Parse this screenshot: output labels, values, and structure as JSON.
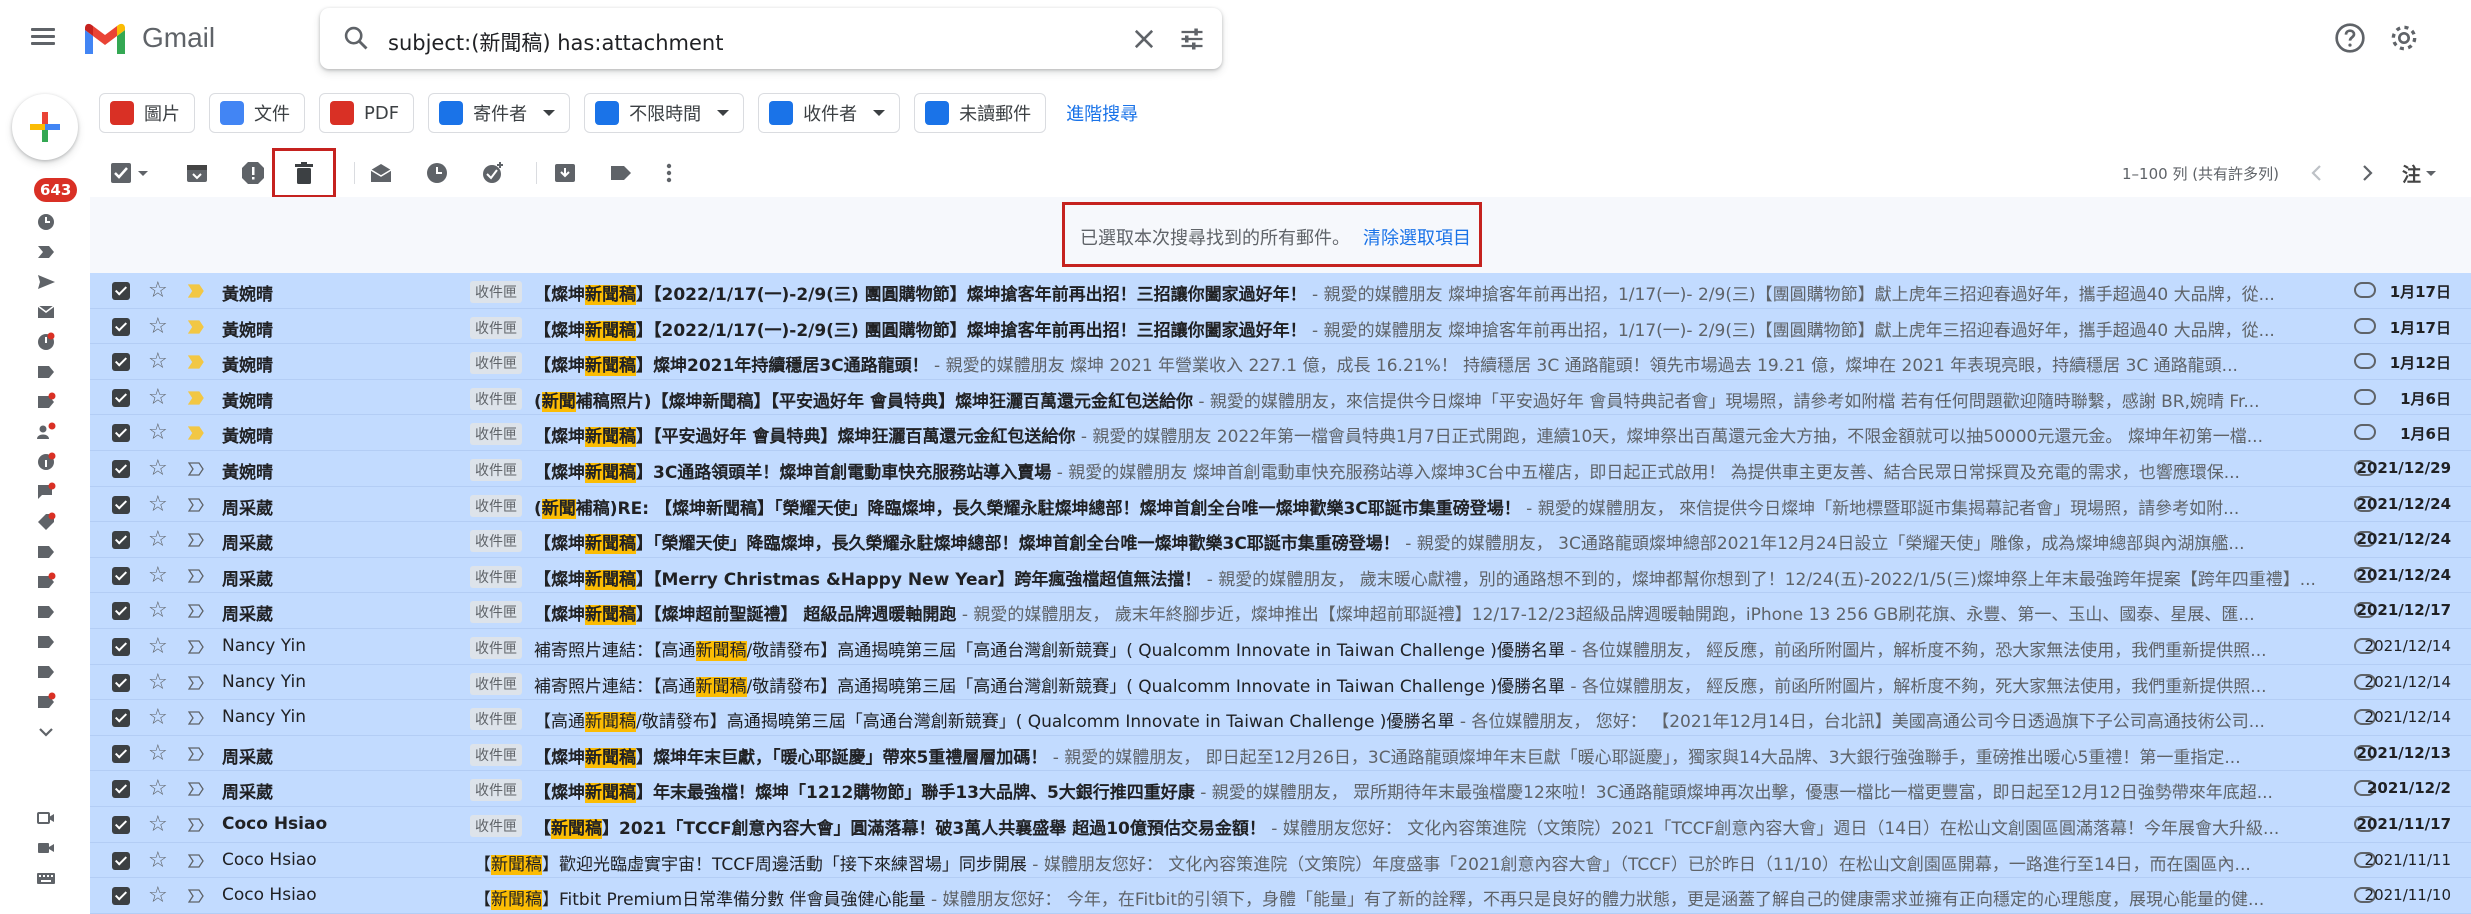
{
  "app": {
    "name": "Gmail"
  },
  "search": {
    "query": "subject:(新聞稿) has:attachment"
  },
  "rail": {
    "unread_count": "643"
  },
  "chips": [
    {
      "label": "圖片",
      "color": "#d93025",
      "icon": "image-icon",
      "dropdown": false
    },
    {
      "label": "文件",
      "color": "#4285f4",
      "icon": "doc-icon",
      "dropdown": false
    },
    {
      "label": "PDF",
      "color": "#d93025",
      "icon": "pdf-icon",
      "dropdown": false
    },
    {
      "label": "寄件者",
      "color": "#1a73e8",
      "icon": "person-icon",
      "dropdown": true
    },
    {
      "label": "不限時間",
      "color": "#1a73e8",
      "icon": "calendar-icon",
      "dropdown": true
    },
    {
      "label": "收件者",
      "color": "#1a73e8",
      "icon": "send-icon",
      "dropdown": true
    },
    {
      "label": "未讀郵件",
      "color": "#1a73e8",
      "icon": "unread-mail-icon",
      "dropdown": false
    }
  ],
  "advanced_search": "進階搜尋",
  "toolbar": {
    "pager": "1–100 列 (共有許多列)",
    "sort": "注"
  },
  "banner": {
    "text": "已選取本次搜尋找到的所有郵件。",
    "clear_link": "清除選取項目"
  },
  "emails": [
    {
      "sender": "黃婉晴",
      "label": "收件匣",
      "pre": "【燦坤",
      "hl": "新聞稿",
      "post": "】【2022/1/17(一)-2/9(三) 團圓購物節】燦坤搶客年前再出招！三招讓你闔家過好年！",
      "snippet": " - 親愛的媒體朋友 燦坤搶客年前再出招，1/17(一)- 2/9(三)【團圓購物節】獻上虎年三招迎春過好年，攜手超過40 大品牌，從...",
      "date": "1月17日",
      "important": true,
      "unread": true
    },
    {
      "sender": "黃婉晴",
      "label": "收件匣",
      "pre": "【燦坤",
      "hl": "新聞稿",
      "post": "】【2022/1/17(一)-2/9(三) 團圓購物節】燦坤搶客年前再出招！三招讓你闔家過好年！",
      "snippet": " - 親愛的媒體朋友 燦坤搶客年前再出招，1/17(一)- 2/9(三)【團圓購物節】獻上虎年三招迎春過好年，攜手超過40 大品牌，從...",
      "date": "1月17日",
      "important": true,
      "unread": true
    },
    {
      "sender": "黃婉晴",
      "label": "收件匣",
      "pre": "【燦坤",
      "hl": "新聞稿",
      "post": "】燦坤2021年持續穩居3C通路龍頭！",
      "snippet": " - 親愛的媒體朋友 燦坤 2021 年營業收入 227.1 億，成長 16.21%！ 持續穩居 3C 通路龍頭！領先市場過去 19.21 億，燦坤在 2021 年表現亮眼，持續穩居 3C 通路龍頭...",
      "date": "1月12日",
      "important": true,
      "unread": true
    },
    {
      "sender": "黃婉晴",
      "label": "收件匣",
      "pre": "(",
      "hl": "新聞",
      "post": "補稿照片)【燦坤新聞稿】【平安過好年 會員特典】燦坤狂灑百萬還元金紅包送給你",
      "snippet": " - 親愛的媒體朋友，來信提供今日燦坤「平安過好年 會員特典記者會」現場照，請參考如附檔 若有任何問題歡迎隨時聯繫，感謝 BR,婉晴 Fr...",
      "date": "1月6日",
      "important": true,
      "unread": true
    },
    {
      "sender": "黃婉晴",
      "label": "收件匣",
      "pre": "【燦坤",
      "hl": "新聞稿",
      "post": "】【平安過好年 會員特典】燦坤狂灑百萬還元金紅包送給你",
      "snippet": " - 親愛的媒體朋友 2022年第一檔會員特典1月7日正式開跑，連續10天，燦坤祭出百萬還元金大方抽，不限金額就可以抽50000元還元金。 燦坤年初第一檔...",
      "date": "1月6日",
      "important": true,
      "unread": true
    },
    {
      "sender": "黃婉晴",
      "label": "收件匣",
      "pre": "【燦坤",
      "hl": "新聞稿",
      "post": "】3C通路領頭羊！燦坤首創電動車快充服務站導入賣場",
      "snippet": " - 親愛的媒體朋友 燦坤首創電動車快充服務站導入燦坤3C台中五權店，即日起正式啟用！ 為提供車主更友善、結合民眾日常採買及充電的需求，也響應環保...",
      "date": "2021/12/29",
      "important": false,
      "unread": true
    },
    {
      "sender": "周采葳",
      "label": "收件匣",
      "pre": "(",
      "hl": "新聞",
      "post": "補稿)RE: 【燦坤新聞稿】「榮耀天使」降臨燦坤，長久榮耀永駐燦坤總部！燦坤首創全台唯一燦坤歡樂3C耶誕市集重磅登場！",
      "snippet": " - 親愛的媒體朋友， 來信提供今日燦坤「新地標暨耶誕市集揭幕記者會」現場照，請參考如附...",
      "date": "2021/12/24",
      "important": false,
      "unread": true
    },
    {
      "sender": "周采葳",
      "label": "收件匣",
      "pre": "【燦坤",
      "hl": "新聞稿",
      "post": "】「榮耀天使」降臨燦坤，長久榮耀永駐燦坤總部！燦坤首創全台唯一燦坤歡樂3C耶誕市集重磅登場！",
      "snippet": " - 親愛的媒體朋友， 3C通路龍頭燦坤總部2021年12月24日設立「榮耀天使」雕像，成為燦坤總部與內湖旗艦...",
      "date": "2021/12/24",
      "important": false,
      "unread": true
    },
    {
      "sender": "周采葳",
      "label": "收件匣",
      "pre": "【燦坤",
      "hl": "新聞稿",
      "post": "】【Merry Christmas &Happy New Year】跨年瘋強檔超值無法擋！",
      "snippet": " - 親愛的媒體朋友， 歲末暖心獻禮，別的通路想不到的，燦坤都幫你想到了！12/24(五)-2022/1/5(三)燦坤祭上年末最強跨年提案【跨年四重禮】...",
      "date": "2021/12/24",
      "important": false,
      "unread": true
    },
    {
      "sender": "周采葳",
      "label": "收件匣",
      "pre": "【燦坤",
      "hl": "新聞稿",
      "post": "】【燦坤超前聖誕禮】 超級品牌週暖軸開跑",
      "snippet": " - 親愛的媒體朋友， 歲末年終腳步近，燦坤推出【燦坤超前耶誕禮】12/17-12/23超級品牌週暖軸開跑，iPhone 13 256 GB刷花旗、永豐、第一、玉山、國泰、星展、匯...",
      "date": "2021/12/17",
      "important": false,
      "unread": true
    },
    {
      "sender": "Nancy Yin",
      "label": "收件匣",
      "pre": "補寄照片連結：【高通",
      "hl": "新聞稿",
      "post": "/敬請發布】高通揭曉第三屆「高通台灣創新競賽」( Qualcomm Innovate in Taiwan Challenge )優勝名單",
      "snippet": " - 各位媒體朋友， 經反應，前函所附圖片，解析度不夠，恐大家無法使用，我們重新提供照...",
      "date": "2021/12/14",
      "important": false,
      "unread": false
    },
    {
      "sender": "Nancy Yin",
      "label": "收件匣",
      "pre": "補寄照片連結：【高通",
      "hl": "新聞稿",
      "post": "/敬請發布】高通揭曉第三屆「高通台灣創新競賽」( Qualcomm Innovate in Taiwan Challenge )優勝名單",
      "snippet": " - 各位媒體朋友， 經反應，前函所附圖片，解析度不夠，死大家無法使用，我們重新提供照...",
      "date": "2021/12/14",
      "important": false,
      "unread": false
    },
    {
      "sender": "Nancy Yin",
      "label": "收件匣",
      "pre": "【高通",
      "hl": "新聞稿",
      "post": "/敬請發布】高通揭曉第三屆「高通台灣創新競賽」( Qualcomm Innovate in Taiwan Challenge )優勝名單",
      "snippet": " - 各位媒體朋友， 您好： 【2021年12月14日，台北訊】美國高通公司今日透過旗下子公司高通技術公司...",
      "date": "2021/12/14",
      "important": false,
      "unread": false
    },
    {
      "sender": "周采葳",
      "label": "收件匣",
      "pre": "【燦坤",
      "hl": "新聞稿",
      "post": "】燦坤年末巨獻，「暖心耶誕慶」帶來5重禮層層加碼！",
      "snippet": " - 親愛的媒體朋友， 即日起至12月26日，3C通路龍頭燦坤年末巨獻「暖心耶誕慶」，獨家與14大品牌、3大銀行強強聯手，重磅推出暖心5重禮！第一重指定...",
      "date": "2021/12/13",
      "important": false,
      "unread": true
    },
    {
      "sender": "周采葳",
      "label": "收件匣",
      "pre": "【燦坤",
      "hl": "新聞稿",
      "post": "】年末最強檔！燦坤「1212購物節」聯手13大品牌、5大銀行推四重好康",
      "snippet": " - 親愛的媒體朋友， 眾所期待年末最強檔慶12來啦！3C通路龍頭燦坤再次出擊，優惠一檔比一檔更豐富，即日起至12月12日強勢帶來年底超...",
      "date": "2021/12/2",
      "important": false,
      "unread": true
    },
    {
      "sender": "Coco Hsiao",
      "label": "收件匣",
      "pre": "【",
      "hl": "新聞稿",
      "post": "】2021「TCCF創意內容大會」圓滿落幕！破3萬人共襄盛舉 超過10億預估交易金額！",
      "snippet": " - 媒體朋友您好： 文化內容策進院（文策院）2021「TCCF創意內容大會」週日（14日）在松山文創園區圓滿落幕！今年展會大升級...",
      "date": "2021/11/17",
      "important": false,
      "unread": true
    },
    {
      "sender": "Coco Hsiao",
      "label": "",
      "pre": "【",
      "hl": "新聞稿",
      "post": "】歡迎光臨虛實宇宙！TCCF周邊活動「接下來練習場」同步開展",
      "snippet": " - 媒體朋友您好： 文化內容策進院（文策院）年度盛事「2021創意內容大會」（TCCF）已於昨日（11/10）在松山文創園區開幕，一路進行至14日，而在園區內...",
      "date": "2021/11/11",
      "important": false,
      "unread": false
    },
    {
      "sender": "Coco Hsiao",
      "label": "",
      "pre": "【",
      "hl": "新聞稿",
      "post": "】Fitbit Premium日常準備分數 伴會員強健心能量",
      "snippet": " - 媒體朋友您好： 今年，在Fitbit的引領下，身體「能量」有了新的詮釋，不再只是良好的體力狀態，更是涵蓋了解自己的健康需求並擁有正向穩定的心理態度，展現心能量的健...",
      "date": "2021/11/10",
      "important": false,
      "unread": false
    }
  ]
}
